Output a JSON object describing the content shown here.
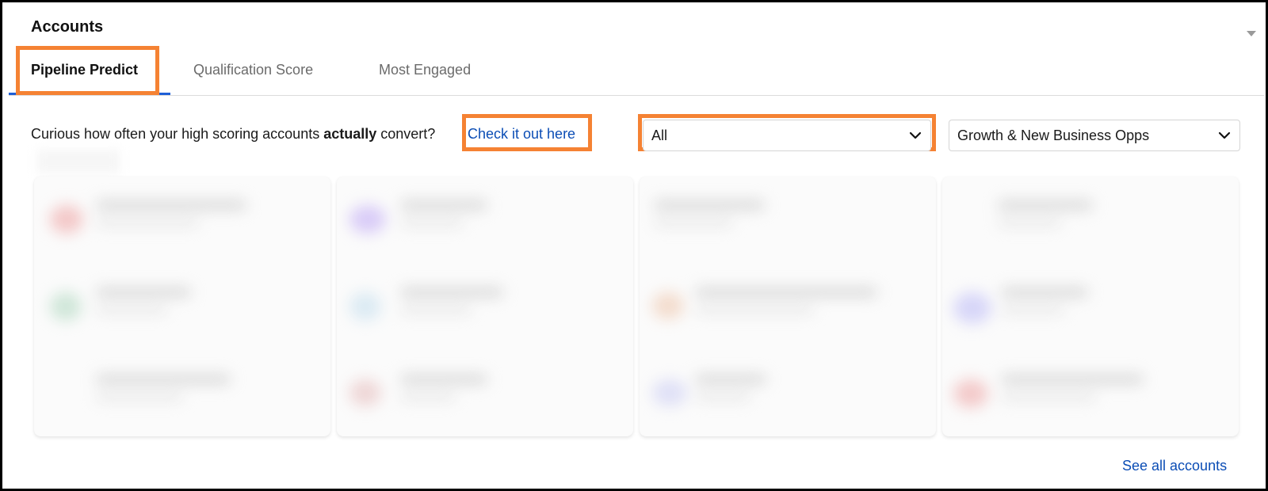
{
  "panel": {
    "title": "Accounts"
  },
  "tabs": [
    {
      "label": "Pipeline Predict",
      "active": true
    },
    {
      "label": "Qualification Score",
      "active": false
    },
    {
      "label": "Most Engaged",
      "active": false
    }
  ],
  "intro": {
    "text_before": "Curious how often your high scoring accounts ",
    "emphasis": "actually",
    "text_after": " convert?",
    "link_label": "Check it out here"
  },
  "filters": {
    "first": {
      "selected": "All",
      "icon": "chevron-down-icon"
    },
    "second": {
      "selected": "Growth & New Business Opps",
      "icon": "chevron-down-icon"
    }
  },
  "footer": {
    "see_all_label": "See all accounts"
  },
  "colors": {
    "link": "#0b4db5",
    "tab_underline": "#1f5fd6",
    "highlight": "#f58233"
  }
}
